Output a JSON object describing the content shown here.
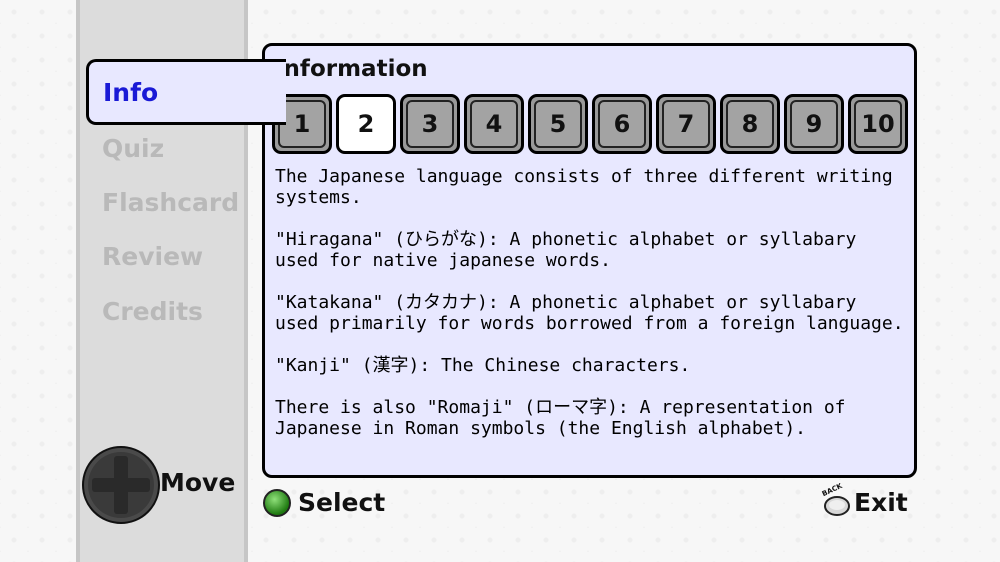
{
  "menu": {
    "active": "Info",
    "items": [
      "Quiz",
      "Flashcard",
      "Review",
      "Credits"
    ]
  },
  "panel": {
    "title": "Information",
    "tabs": [
      "1",
      "2",
      "3",
      "4",
      "5",
      "6",
      "7",
      "8",
      "9",
      "10"
    ],
    "active_tab": "2",
    "paragraphs": [
      "The Japanese language consists of three different writing systems.",
      "\"Hiragana\" (ひらがな): A phonetic alphabet or syllabary used for native japanese words.",
      "\"Katakana\" (カタカナ): A phonetic alphabet or syllabary used primarily for words borrowed from a foreign language.",
      "\"Kanji\" (漢字): The Chinese characters.",
      "There is also \"Romaji\" (ローマ字): A representation of Japanese in Roman symbols (the English alphabet)."
    ]
  },
  "controls": {
    "move_label": "Move",
    "select_label": "Select",
    "exit_label": "Exit",
    "back_button_text": "BACK"
  },
  "colors": {
    "active_menu_text": "#1a1ad6",
    "inactive_menu_text": "#b9b9b9",
    "panel_bg": "#e8e8ff",
    "select_button": "#2e9a1c"
  }
}
